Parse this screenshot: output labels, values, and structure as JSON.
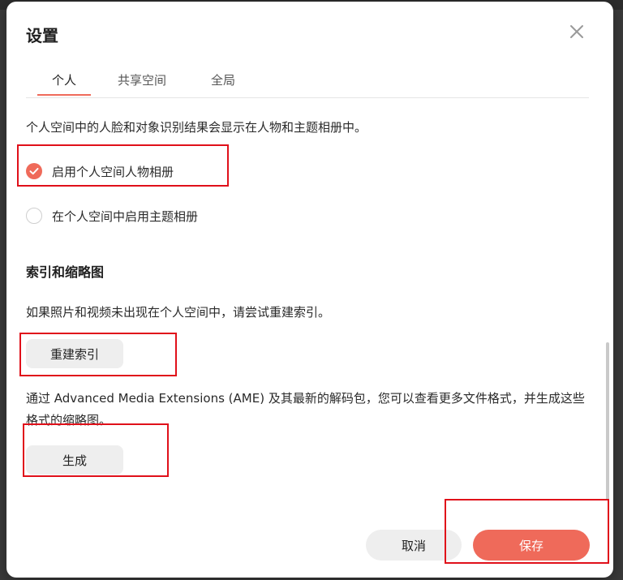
{
  "dialog": {
    "title": "设置",
    "close_icon": "close-icon"
  },
  "tabs": [
    {
      "label": "个人",
      "active": true
    },
    {
      "label": "共享空间",
      "active": false
    },
    {
      "label": "全局",
      "active": false
    }
  ],
  "personal": {
    "description": "个人空间中的人脸和对象识别结果会显示在人物和主题相册中。",
    "options": [
      {
        "label": "启用个人空间人物相册",
        "checked": true
      },
      {
        "label": "在个人空间中启用主题相册",
        "checked": false
      }
    ]
  },
  "index_section": {
    "title": "索引和缩略图",
    "reindex_description": "如果照片和视频未出现在个人空间中，请尝试重建索引。",
    "reindex_button": "重建索引",
    "ame_description": "通过 Advanced Media Extensions (AME) 及其最新的解码包，您可以查看更多文件格式，并生成这些格式的缩略图。",
    "generate_button": "生成"
  },
  "footer": {
    "cancel_label": "取消",
    "save_label": "保存"
  },
  "colors": {
    "accent": "#ef6a5a",
    "highlight_box": "#e0101a"
  }
}
